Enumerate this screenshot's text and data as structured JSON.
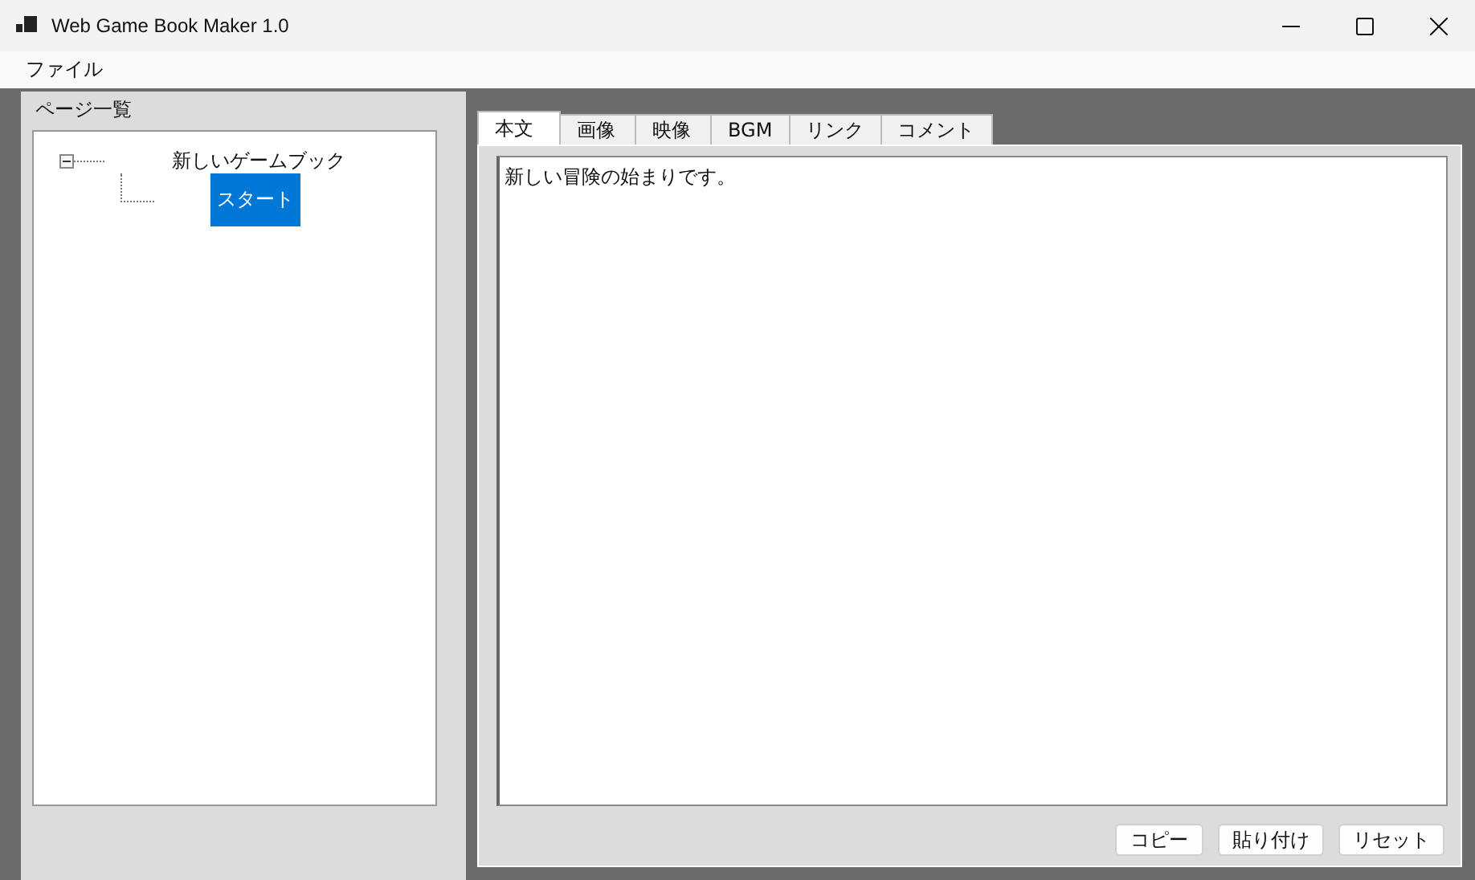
{
  "window": {
    "title": "Web Game Book Maker 1.0"
  },
  "menu": [
    "ファイル"
  ],
  "page_list": {
    "title": "ページ一覧",
    "tree": [
      {
        "label": "新しいゲームブック",
        "expanded": true,
        "selected": false,
        "children": [
          {
            "label": "スタート",
            "selected": true
          }
        ]
      }
    ]
  },
  "tabs": [
    {
      "label": "本文",
      "selected": true
    },
    {
      "label": "画像",
      "selected": false
    },
    {
      "label": "映像",
      "selected": false
    },
    {
      "label": "BGM",
      "selected": false
    },
    {
      "label": "リンク",
      "selected": false
    },
    {
      "label": "コメント",
      "selected": false
    }
  ],
  "body_text": "新しい冒険の始まりです。",
  "buttons": [
    "コピー",
    "貼り付け",
    "リセット"
  ]
}
